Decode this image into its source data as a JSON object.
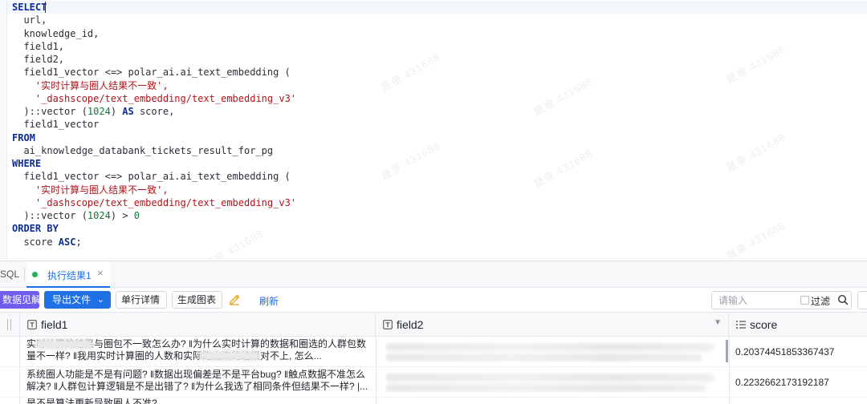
{
  "editor": {
    "lines": [
      [
        {
          "t": "SELECT",
          "c": "kw"
        }
      ],
      [
        {
          "t": "  url,"
        }
      ],
      [
        {
          "t": "  knowledge_id,"
        }
      ],
      [
        {
          "t": "  field1,"
        }
      ],
      [
        {
          "t": "  field2,"
        }
      ],
      [
        {
          "t": "  field1_vector <=> polar_ai.ai_text_embedding ("
        }
      ],
      [
        {
          "t": "    "
        },
        {
          "t": "'实时计算与圈人结果不一致',",
          "c": "str"
        }
      ],
      [
        {
          "t": "    "
        },
        {
          "t": "'_dashscope/text_embedding/text_embedding_v3'",
          "c": "str"
        }
      ],
      [
        {
          "t": "  )::vector ("
        },
        {
          "t": "1024",
          "c": "num"
        },
        {
          "t": ") "
        },
        {
          "t": "AS",
          "c": "kw"
        },
        {
          "t": " score,"
        }
      ],
      [
        {
          "t": "  field1_vector"
        }
      ],
      [
        {
          "t": "FROM",
          "c": "kw"
        }
      ],
      [
        {
          "t": "  ai_knowledge_databank_tickets_result_for_pg"
        }
      ],
      [
        {
          "t": "WHERE",
          "c": "kw"
        }
      ],
      [
        {
          "t": "  field1_vector <=> polar_ai.ai_text_embedding ("
        }
      ],
      [
        {
          "t": "    "
        },
        {
          "t": "'实时计算与圈人结果不一致',",
          "c": "str"
        }
      ],
      [
        {
          "t": "    "
        },
        {
          "t": "'_dashscope/text_embedding/text_embedding_v3'",
          "c": "str"
        }
      ],
      [
        {
          "t": "  )::vector ("
        },
        {
          "t": "1024",
          "c": "num"
        },
        {
          "t": ") > "
        },
        {
          "t": "0",
          "c": "num"
        }
      ],
      [
        {
          "t": "ORDER BY",
          "c": "kw"
        }
      ],
      [
        {
          "t": "  score "
        },
        {
          "t": "ASC",
          "c": "kw"
        },
        {
          "t": ";"
        }
      ]
    ],
    "watermark_text": "晟泉 431688"
  },
  "tabs": {
    "sql_label": "SQL",
    "result_label": "执行结果1",
    "close_glyph": "×"
  },
  "toolbar": {
    "insight_label": "数据见解",
    "export_label": "导出文件",
    "export_chevron": "⌄",
    "detail_label": "单行详情",
    "chart_label": "生成图表",
    "refresh_label": "刷新",
    "search_placeholder": "请输入",
    "filter_label": "过滤"
  },
  "table": {
    "columns": [
      {
        "key": "field1",
        "label": "field1",
        "type_icon": "text-type-icon"
      },
      {
        "key": "field2",
        "label": "field2",
        "type_icon": "text-type-icon"
      },
      {
        "key": "score",
        "label": "score",
        "type_icon": "number-list-icon"
      }
    ],
    "rows": [
      {
        "field1": "实时计算的结果与圈包不一致怎么办? ‖为什么实时计算的数据和圈选的人群包数量不一样? ‖我用实时计算圈的人数和实际跑出来的结果对不上, 怎么...",
        "score": "0.20374451853367437"
      },
      {
        "field1": "系统圈人功能是不是有问题? ‖数据出现偏差是不是平台bug? ‖触点数据不准怎么解决? ‖人群包计算逻辑是不是出错了? ‖为什么我选了相同条件但结果不一样? |...",
        "score": "0.2232662173192187"
      },
      {
        "field1": "是不是算法更新导致圈人不准?",
        "score": ""
      }
    ]
  },
  "colors": {
    "accent": "#1f6fe5",
    "insight": "#6f5df0",
    "keyword": "#0d2c99",
    "string": "#b0141b",
    "number": "#117a3a",
    "status_dot": "#1fb35a"
  }
}
